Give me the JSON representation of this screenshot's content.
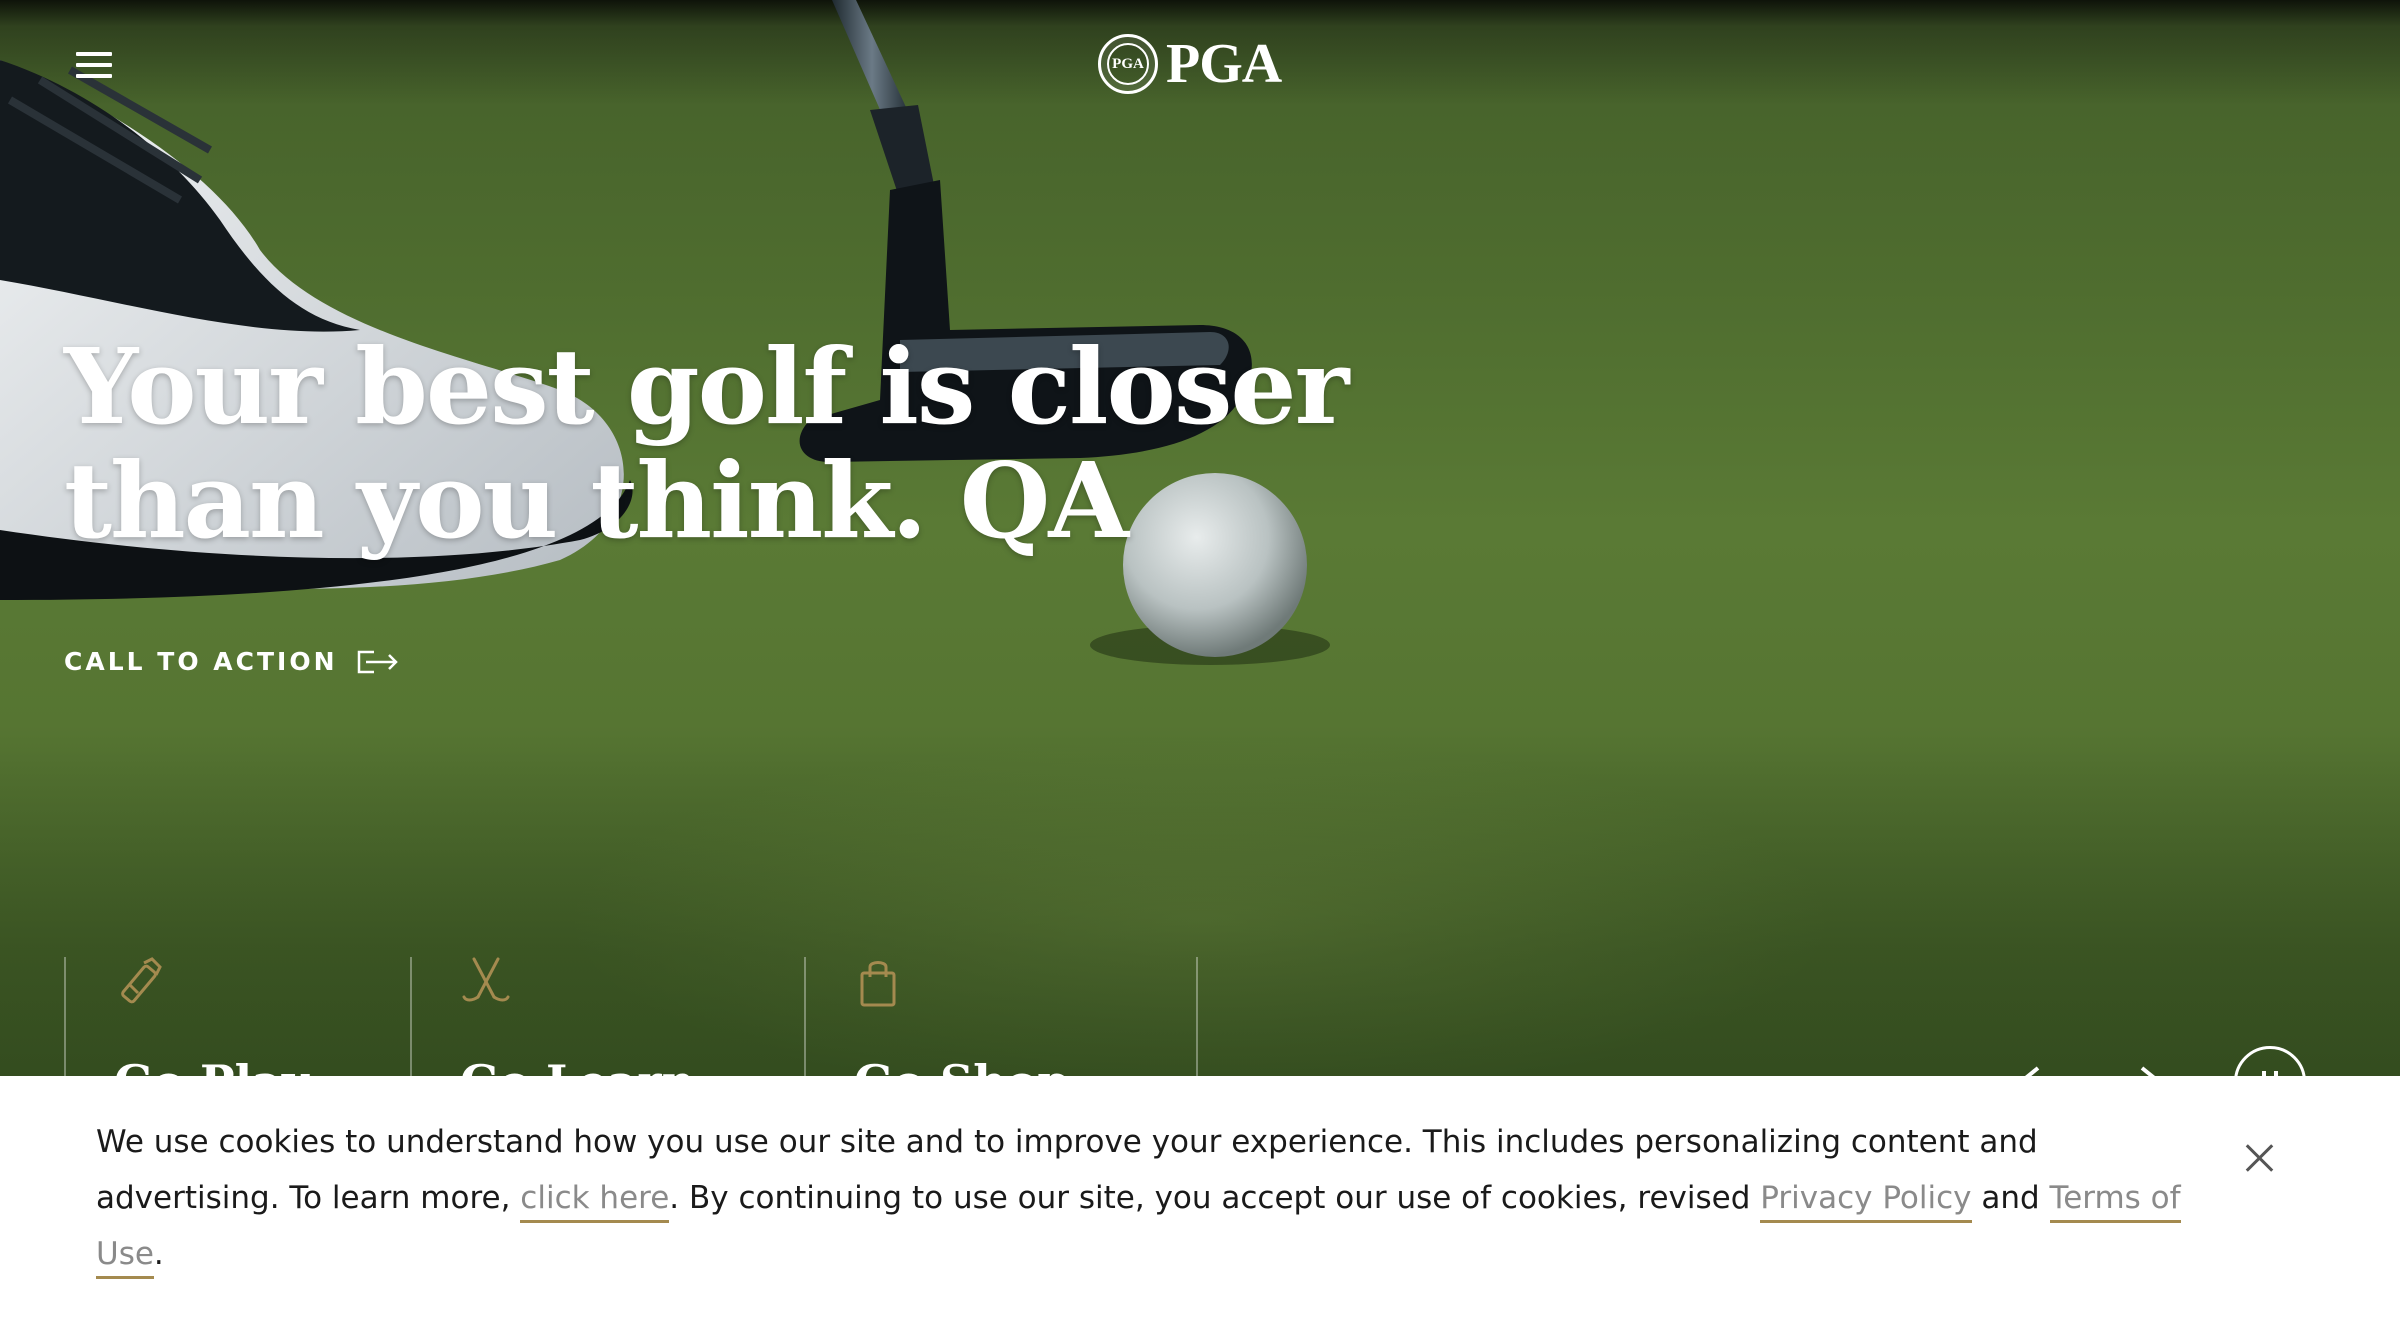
{
  "header": {
    "menu_icon": "hamburger-menu-icon",
    "logo_text": "PGA",
    "logo_seal_text": "PGA"
  },
  "hero": {
    "headline_line1": "Your best golf is closer",
    "headline_line2": "than you think. QA",
    "cta_label": "CALL TO ACTION",
    "cta_icon": "arrow-out-icon"
  },
  "quick_links": [
    {
      "label": "Go Play",
      "icon": "golf-bag-icon"
    },
    {
      "label": "Go Learn",
      "icon": "crossed-clubs-icon"
    },
    {
      "label": "Go Shop",
      "icon": "shopping-bag-icon"
    }
  ],
  "carousel": {
    "prev_icon": "chevron-left-icon",
    "next_icon": "chevron-right-icon",
    "pause_icon": "pause-icon"
  },
  "cookie_banner": {
    "text_part1": "We use cookies to understand how you use our site and to improve your experience. This includes personalizing content and advertising. To learn more, ",
    "link_click_here": "click here",
    "text_part2": ". By continuing to use our site, you accept our use of cookies, revised ",
    "link_privacy": "Privacy Policy",
    "text_and": " and ",
    "link_terms": "Terms of Use",
    "text_end": ".",
    "close_icon": "close-icon"
  },
  "colors": {
    "accent_gold": "#a48a4f",
    "link_gray": "#8a8a8a",
    "grass_green": "#567532"
  }
}
